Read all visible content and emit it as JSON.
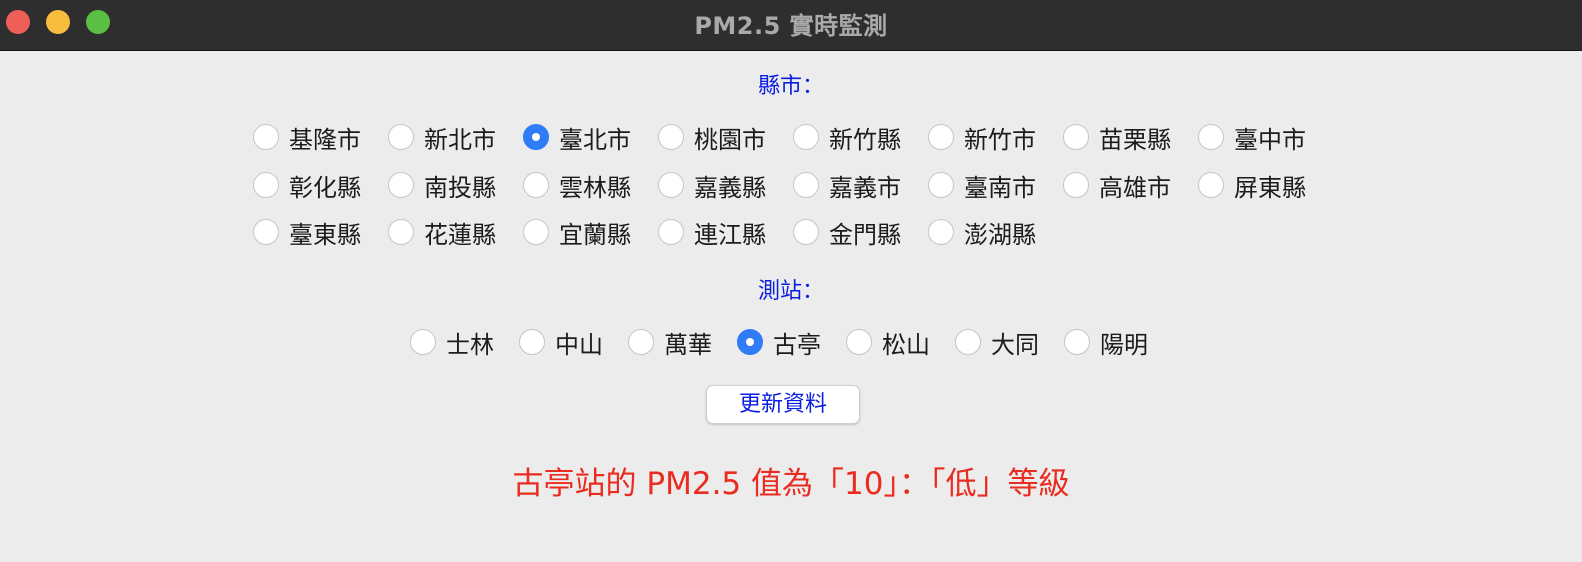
{
  "window": {
    "title": "PM2.5 實時監測",
    "controls": [
      "close",
      "minimize",
      "zoom"
    ]
  },
  "county_section": {
    "label": "縣市："
  },
  "counties": [
    {
      "label": "基隆市",
      "checked": false
    },
    {
      "label": "新北市",
      "checked": false
    },
    {
      "label": "臺北市",
      "checked": true
    },
    {
      "label": "桃園市",
      "checked": false
    },
    {
      "label": "新竹縣",
      "checked": false
    },
    {
      "label": "新竹市",
      "checked": false
    },
    {
      "label": "苗栗縣",
      "checked": false
    },
    {
      "label": "臺中市",
      "checked": false
    },
    {
      "label": "彰化縣",
      "checked": false
    },
    {
      "label": "南投縣",
      "checked": false
    },
    {
      "label": "雲林縣",
      "checked": false
    },
    {
      "label": "嘉義縣",
      "checked": false
    },
    {
      "label": "嘉義市",
      "checked": false
    },
    {
      "label": "臺南市",
      "checked": false
    },
    {
      "label": "高雄市",
      "checked": false
    },
    {
      "label": "屏東縣",
      "checked": false
    },
    {
      "label": "臺東縣",
      "checked": false
    },
    {
      "label": "花蓮縣",
      "checked": false
    },
    {
      "label": "宜蘭縣",
      "checked": false
    },
    {
      "label": "連江縣",
      "checked": false
    },
    {
      "label": "金門縣",
      "checked": false
    },
    {
      "label": "澎湖縣",
      "checked": false
    }
  ],
  "station_section": {
    "label": "測站："
  },
  "stations": [
    {
      "label": "士林",
      "checked": false
    },
    {
      "label": "中山",
      "checked": false
    },
    {
      "label": "萬華",
      "checked": false
    },
    {
      "label": "古亭",
      "checked": true
    },
    {
      "label": "松山",
      "checked": false
    },
    {
      "label": "大同",
      "checked": false
    },
    {
      "label": "陽明",
      "checked": false
    }
  ],
  "update_button": {
    "label": "更新資料"
  },
  "result_text": "古亭站的 PM2.5 值為「10」：「低」等級",
  "colors": {
    "accent_text": "#0a1ee0",
    "result_text": "#ea2b20",
    "radio_selected": "#2f7cf6",
    "titlebar": "#2e2e2e",
    "background": "#ececec"
  }
}
